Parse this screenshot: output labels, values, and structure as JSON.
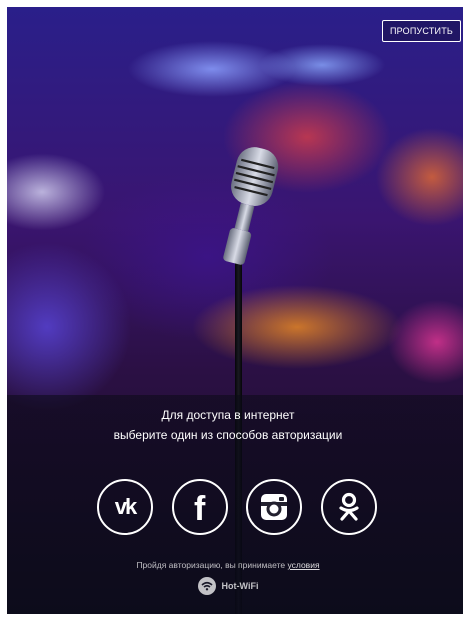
{
  "header": {
    "skip_label": "ПРОПУСТИТЬ"
  },
  "prompt": {
    "line1": "Для доступа в интернет",
    "line2": "выберите один из способов авторизации"
  },
  "social": [
    {
      "name": "vk",
      "glyph": "vk",
      "icon": "vk-icon"
    },
    {
      "name": "facebook",
      "glyph": "f",
      "icon": "facebook-icon"
    },
    {
      "name": "instagram",
      "icon": "instagram-icon"
    },
    {
      "name": "odnoklassniki",
      "icon": "odnoklassniki-icon"
    }
  ],
  "terms": {
    "text": "Пройдя авторизацию, вы принимаете",
    "link": "условия"
  },
  "brand": {
    "name": "Hot-WiFi",
    "icon": "wifi-icon"
  },
  "colors": {
    "foreground": "#ffffff",
    "overlay": "#0a0a1a"
  }
}
